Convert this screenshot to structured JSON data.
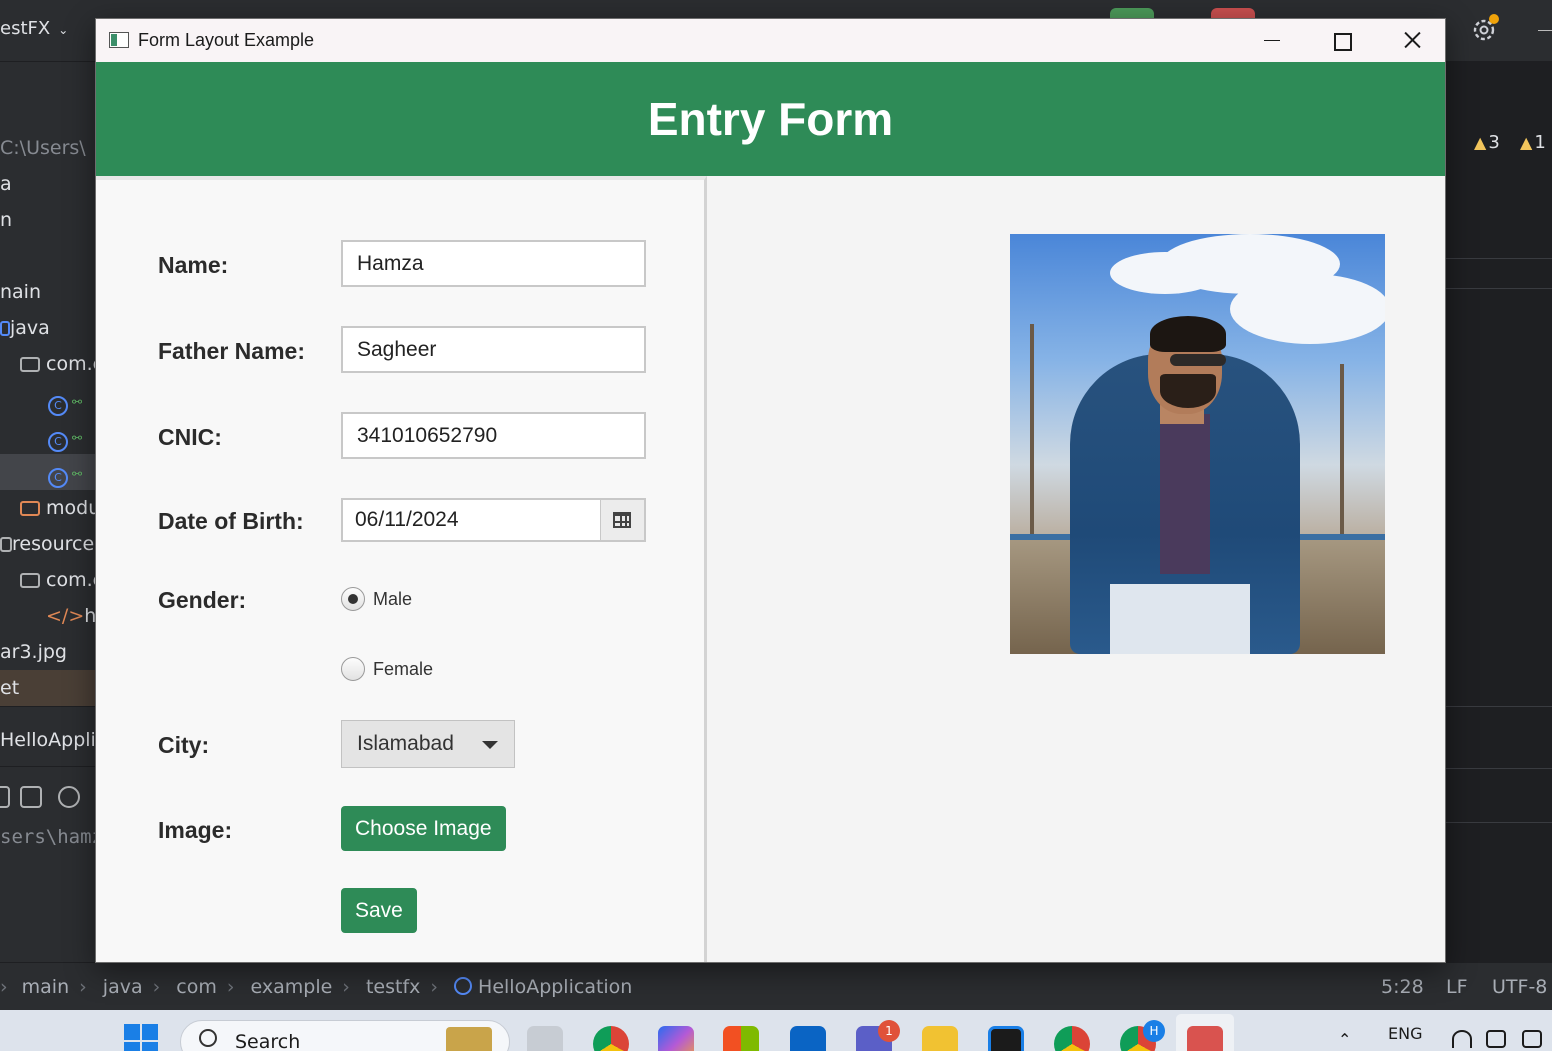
{
  "ide": {
    "project_name": "estFX",
    "tree": [
      {
        "label": "C:\\Users\\"
      },
      {
        "label": "a"
      },
      {
        "label": "n"
      },
      {
        "label": "nain"
      },
      {
        "label": "java"
      },
      {
        "label": "com.e"
      },
      {
        "label": "modu"
      },
      {
        "label": "resource"
      },
      {
        "label": "com.e"
      },
      {
        "label": "he"
      },
      {
        "label": "ar3.jpg"
      },
      {
        "label": "et"
      },
      {
        "label": "HelloAppli"
      }
    ],
    "terminal_text": "sers\\hamz",
    "warnings": {
      "count_a": "3",
      "count_b": "1"
    },
    "breadcrumb": [
      "main",
      "java",
      "com",
      "example",
      "testfx",
      "HelloApplication"
    ],
    "status": {
      "position": "5:28",
      "line_sep": "LF",
      "encoding": "UTF-8"
    }
  },
  "taskbar": {
    "search_label": "Search",
    "teams_badge": "1",
    "edge_profile_badge": "H",
    "lang": "ENG"
  },
  "window": {
    "title": "Form Layout Example",
    "icon": "java-app-icon"
  },
  "form": {
    "heading": "Entry Form",
    "name": {
      "label": "Name:",
      "value": "Hamza"
    },
    "father_name": {
      "label": "Father Name:",
      "value": "Sagheer"
    },
    "cnic": {
      "label": "CNIC:",
      "value": "341010652790"
    },
    "dob": {
      "label": "Date of Birth:",
      "value": "06/11/2024",
      "icon": "calendar-icon"
    },
    "gender": {
      "label": "Gender:",
      "options": [
        {
          "label": "Male",
          "selected": true
        },
        {
          "label": "Female",
          "selected": false
        }
      ]
    },
    "city": {
      "label": "City:",
      "value": "Islamabad"
    },
    "image": {
      "label": "Image:",
      "button": "Choose Image"
    },
    "save_button": "Save"
  },
  "colors": {
    "accent": "#2e8b57",
    "header_text": "#ffffff",
    "ide_bg": "#2b2d30"
  }
}
